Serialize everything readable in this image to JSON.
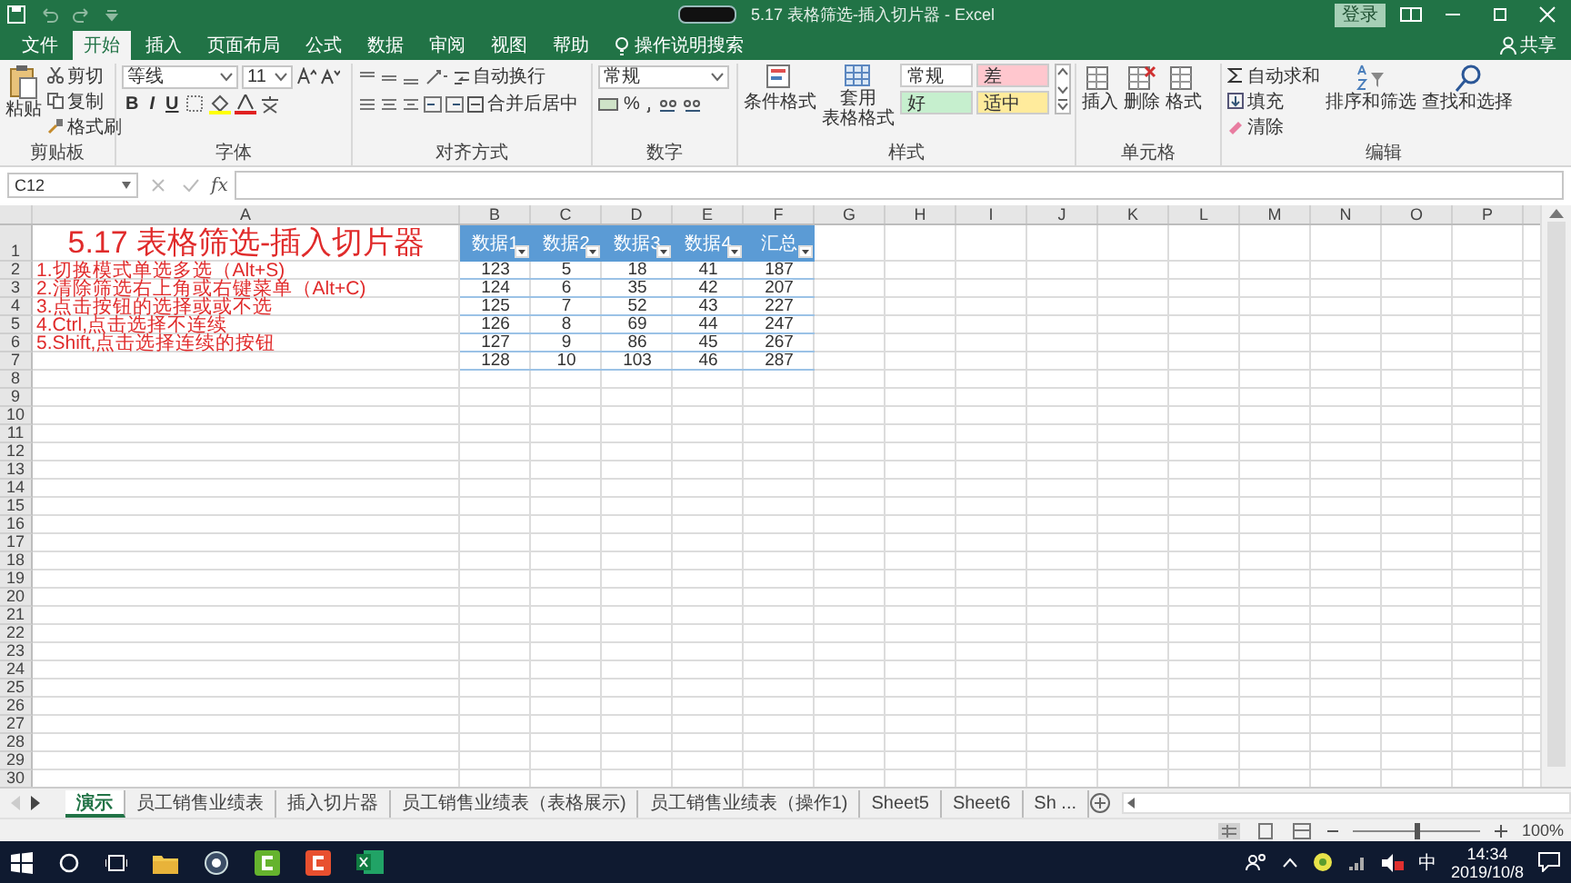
{
  "title_bar": {
    "title": "5.17 表格筛选-插入切片器  -  Excel",
    "login": "登录"
  },
  "ribbon_tabs": [
    {
      "label": "文件",
      "selected": false
    },
    {
      "label": "开始",
      "selected": true
    },
    {
      "label": "插入",
      "selected": false
    },
    {
      "label": "页面布局",
      "selected": false
    },
    {
      "label": "公式",
      "selected": false
    },
    {
      "label": "数据",
      "selected": false
    },
    {
      "label": "审阅",
      "selected": false
    },
    {
      "label": "视图",
      "selected": false
    },
    {
      "label": "帮助",
      "selected": false
    }
  ],
  "tell_me": "操作说明搜索",
  "share": "共享",
  "ribbon": {
    "clipboard": {
      "label": "剪贴板",
      "paste": "粘贴",
      "cut": "剪切",
      "copy": "复制",
      "format_painter": "格式刷"
    },
    "font": {
      "label": "字体",
      "font_name": "等线",
      "font_size": "11",
      "format_buttons": [
        "B",
        "I",
        "U"
      ]
    },
    "alignment": {
      "label": "对齐方式",
      "wrap": "自动换行",
      "merge": "合并后居中"
    },
    "number": {
      "label": "数字",
      "format": "常规",
      "percent": "%"
    },
    "styles": {
      "label": "样式",
      "conditional": "条件格式",
      "table_format": [
        "套用",
        "表格格式"
      ],
      "cell_styles": [
        {
          "label": "常规",
          "color": "#ffffff"
        },
        {
          "label": "差",
          "color": "#ffc7ce"
        },
        {
          "label": "好",
          "color": "#c6efce"
        },
        {
          "label": "适中",
          "color": "#ffeb9c"
        }
      ]
    },
    "cells": {
      "label": "单元格",
      "buttons": [
        "插入",
        "删除",
        "格式"
      ]
    },
    "editing": {
      "label": "编辑",
      "autosum": "自动求和",
      "fill": "填充",
      "clear": "清除",
      "sort": "排序和筛选",
      "find": "查找和选择"
    }
  },
  "formula_bar": {
    "name_box": "C12",
    "function_label": "fx"
  },
  "sheet": {
    "columns": [
      "A",
      "B",
      "C",
      "D",
      "E",
      "F",
      "G",
      "H",
      "I",
      "J",
      "K",
      "L",
      "M",
      "N",
      "O",
      "P"
    ],
    "rows": [
      "1",
      "2",
      "3",
      "4",
      "5",
      "6",
      "7",
      "8",
      "9",
      "10",
      "11",
      "12",
      "13",
      "14",
      "15",
      "16",
      "17",
      "18",
      "19",
      "20",
      "21",
      "22",
      "23",
      "24",
      "25",
      "26",
      "27",
      "28",
      "29",
      "30"
    ],
    "title": "5.17 表格筛选-插入切片器",
    "notes": [
      "1.切换模式单选多选（Alt+S)",
      "2.清除筛选右上角或右键菜单（Alt+C)",
      "3.点击按钮的选择或或不选",
      "4.Ctrl,点击选择不连续",
      "5.Shift,点击选择连续的按钮"
    ],
    "table": {
      "headers": [
        "数据1",
        "数据2",
        "数据3",
        "数据4",
        "汇总"
      ],
      "rows": [
        [
          "123",
          "5",
          "18",
          "41",
          "187"
        ],
        [
          "124",
          "6",
          "35",
          "42",
          "207"
        ],
        [
          "125",
          "7",
          "52",
          "43",
          "227"
        ],
        [
          "126",
          "8",
          "69",
          "44",
          "247"
        ],
        [
          "127",
          "9",
          "86",
          "45",
          "267"
        ],
        [
          "128",
          "10",
          "103",
          "46",
          "287"
        ]
      ]
    }
  },
  "sheet_tabs": [
    {
      "label": "演示",
      "selected": true
    },
    {
      "label": "员工销售业绩表",
      "selected": false
    },
    {
      "label": "插入切片器",
      "selected": false
    },
    {
      "label": "员工销售业绩表（表格展示)",
      "selected": false
    },
    {
      "label": "员工销售业绩表（操作1)",
      "selected": false
    },
    {
      "label": "Sheet5",
      "selected": false
    },
    {
      "label": "Sheet6",
      "selected": false
    },
    {
      "label": "Sh ...",
      "selected": false
    }
  ],
  "status_bar": {
    "zoom": {
      "level": 0.5,
      "reading": "100%"
    }
  },
  "taskbar": {
    "ime": "中",
    "time": "14:34",
    "date": "2019/10/8"
  }
}
